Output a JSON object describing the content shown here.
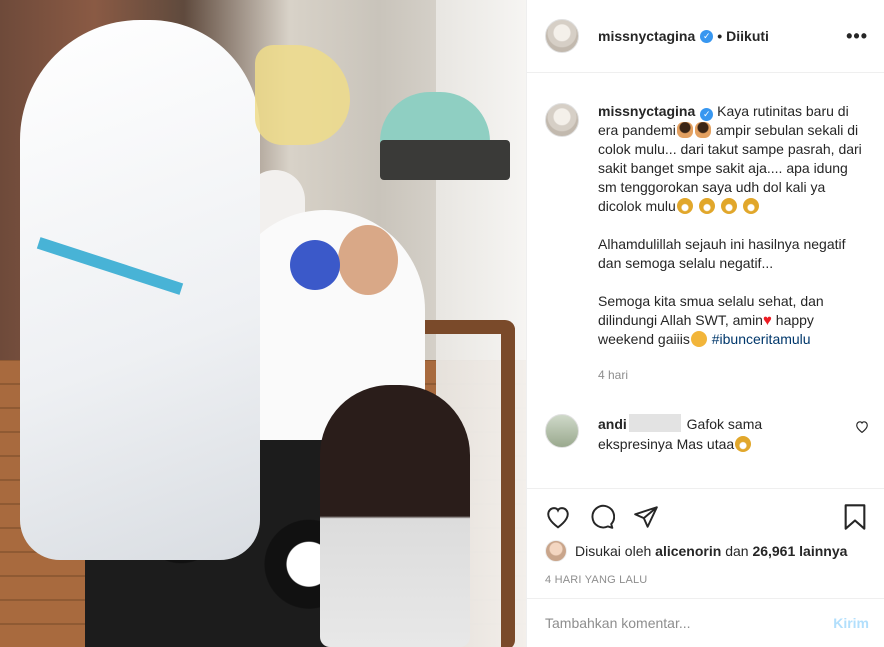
{
  "post": {
    "username": "missnyctagina",
    "follow_status": "Diikuti",
    "dot": "•",
    "more_icon": "more-dots-icon"
  },
  "caption": {
    "username": "missnyctagina",
    "text_1": "Kaya rutinitas baru di era pandemi",
    "text_1b": "ampir sebulan sekali di colok mulu... dari takut sampe pasrah, dari sakit banget smpe sakit aja.... apa idung sm tenggorokan saya udh dol kali ya dicolok mulu",
    "text_2": "Alhamdulillah sejauh ini hasilnya negatif dan semoga selalu negatif...",
    "text_3": "Semoga kita smua selalu sehat, dan dilindungi Allah SWT, amin",
    "text_3b": "happy weekend gaiiis",
    "hashtag": "#ibunceritamulu",
    "time": "4 hari"
  },
  "comment": {
    "username": "andi",
    "text": "Gafok sama ekspresinya Mas utaa"
  },
  "likes": {
    "prefix": "Disukai oleh",
    "user": "alicenorin",
    "connector": "dan",
    "count": "26,961 lainnya"
  },
  "posted_time": "4 HARI YANG LALU",
  "add_comment": {
    "placeholder": "Tambahkan komentar...",
    "send_label": "Kirim"
  },
  "colors": {
    "link": "#00376b",
    "verified": "#3897f0",
    "send_disabled": "#b2dffc",
    "heart": "#ed1c24"
  }
}
